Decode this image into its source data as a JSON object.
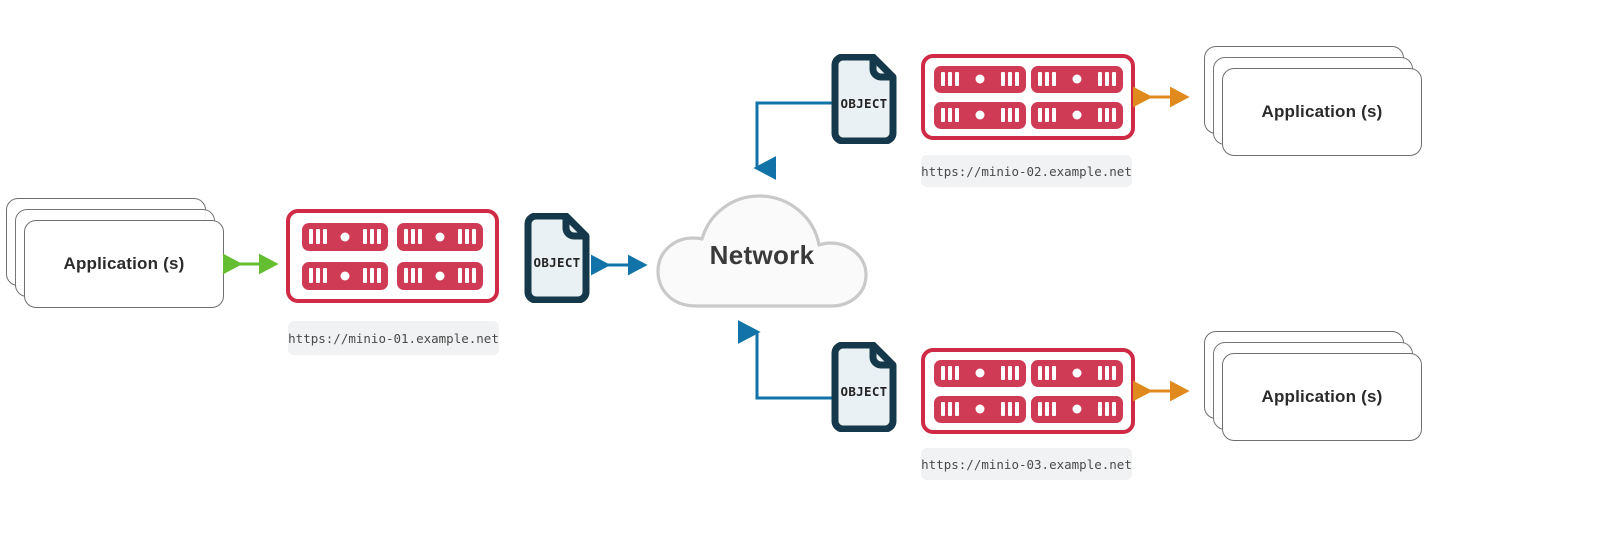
{
  "diagram": {
    "title": "MinIO multi-site object storage network topology",
    "colors": {
      "rack_border": "#cf2b47",
      "server_fill": "#cf3a54",
      "object_border": "#15394a",
      "object_fill": "#eaf1f5",
      "cloud_border": "#c9c9c9",
      "cloud_fill": "#fafafa",
      "arrow_green": "#65bd32",
      "arrow_blue": "#1273a8",
      "arrow_orange": "#e08a1e",
      "pill_bg": "#f1f2f3",
      "app_border": "#6f6f6f"
    }
  },
  "network": {
    "label": "Network",
    "icon": "cloud-icon"
  },
  "sites": [
    {
      "id": "site-01",
      "app_label": "Application (s)",
      "object_label": "OBJECT",
      "url": "https://minio-01.example.net",
      "app_arrow_color": "#65bd32",
      "object_arrow_color": "#1273a8",
      "server_count": 4
    },
    {
      "id": "site-02",
      "app_label": "Application (s)",
      "object_label": "OBJECT",
      "url": "https://minio-02.example.net",
      "app_arrow_color": "#e08a1e",
      "object_arrow_color": "#1273a8",
      "server_count": 4
    },
    {
      "id": "site-03",
      "app_label": "Application (s)",
      "object_label": "OBJECT",
      "url": "https://minio-03.example.net",
      "app_arrow_color": "#e08a1e",
      "object_arrow_color": "#1273a8",
      "server_count": 4
    }
  ]
}
